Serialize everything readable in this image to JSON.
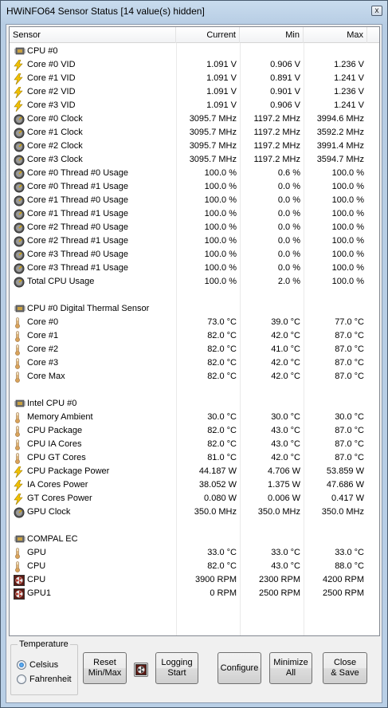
{
  "window": {
    "title": "HWiNFO64 Sensor Status [14 value(s) hidden]",
    "close_glyph": "x"
  },
  "table": {
    "columns": {
      "sensor": "Sensor",
      "current": "Current",
      "min": "Min",
      "max": "Max"
    },
    "rows": [
      {
        "type": "group",
        "icon": "chip-icon",
        "label": "CPU #0"
      },
      {
        "type": "item",
        "icon": "bolt-icon",
        "label": "Core #0 VID",
        "current": "1.091 V",
        "min": "0.906 V",
        "max": "1.236 V"
      },
      {
        "type": "item",
        "icon": "bolt-icon",
        "label": "Core #1 VID",
        "current": "1.091 V",
        "min": "0.891 V",
        "max": "1.241 V"
      },
      {
        "type": "item",
        "icon": "bolt-icon",
        "label": "Core #2 VID",
        "current": "1.091 V",
        "min": "0.901 V",
        "max": "1.236 V"
      },
      {
        "type": "item",
        "icon": "bolt-icon",
        "label": "Core #3 VID",
        "current": "1.091 V",
        "min": "0.906 V",
        "max": "1.241 V"
      },
      {
        "type": "item",
        "icon": "gauge-icon",
        "label": "Core #0 Clock",
        "current": "3095.7 MHz",
        "min": "1197.2 MHz",
        "max": "3994.6 MHz"
      },
      {
        "type": "item",
        "icon": "gauge-icon",
        "label": "Core #1 Clock",
        "current": "3095.7 MHz",
        "min": "1197.2 MHz",
        "max": "3592.2 MHz"
      },
      {
        "type": "item",
        "icon": "gauge-icon",
        "label": "Core #2 Clock",
        "current": "3095.7 MHz",
        "min": "1197.2 MHz",
        "max": "3991.4 MHz"
      },
      {
        "type": "item",
        "icon": "gauge-icon",
        "label": "Core #3 Clock",
        "current": "3095.7 MHz",
        "min": "1197.2 MHz",
        "max": "3594.7 MHz"
      },
      {
        "type": "item",
        "icon": "gauge-icon",
        "label": "Core #0 Thread #0 Usage",
        "current": "100.0 %",
        "min": "0.6 %",
        "max": "100.0 %"
      },
      {
        "type": "item",
        "icon": "gauge-icon",
        "label": "Core #0 Thread #1 Usage",
        "current": "100.0 %",
        "min": "0.0 %",
        "max": "100.0 %"
      },
      {
        "type": "item",
        "icon": "gauge-icon",
        "label": "Core #1 Thread #0 Usage",
        "current": "100.0 %",
        "min": "0.0 %",
        "max": "100.0 %"
      },
      {
        "type": "item",
        "icon": "gauge-icon",
        "label": "Core #1 Thread #1 Usage",
        "current": "100.0 %",
        "min": "0.0 %",
        "max": "100.0 %"
      },
      {
        "type": "item",
        "icon": "gauge-icon",
        "label": "Core #2 Thread #0 Usage",
        "current": "100.0 %",
        "min": "0.0 %",
        "max": "100.0 %"
      },
      {
        "type": "item",
        "icon": "gauge-icon",
        "label": "Core #2 Thread #1 Usage",
        "current": "100.0 %",
        "min": "0.0 %",
        "max": "100.0 %"
      },
      {
        "type": "item",
        "icon": "gauge-icon",
        "label": "Core #3 Thread #0 Usage",
        "current": "100.0 %",
        "min": "0.0 %",
        "max": "100.0 %"
      },
      {
        "type": "item",
        "icon": "gauge-icon",
        "label": "Core #3 Thread #1 Usage",
        "current": "100.0 %",
        "min": "0.0 %",
        "max": "100.0 %"
      },
      {
        "type": "item",
        "icon": "gauge-icon",
        "label": "Total CPU Usage",
        "current": "100.0 %",
        "min": "2.0 %",
        "max": "100.0 %"
      },
      {
        "type": "blank"
      },
      {
        "type": "group",
        "icon": "chip-icon",
        "label": "CPU #0 Digital Thermal Sensor"
      },
      {
        "type": "item",
        "icon": "thermometer-icon",
        "label": "Core #0",
        "current": "73.0 °C",
        "min": "39.0 °C",
        "max": "77.0 °C"
      },
      {
        "type": "item",
        "icon": "thermometer-icon",
        "label": "Core #1",
        "current": "82.0 °C",
        "min": "42.0 °C",
        "max": "87.0 °C"
      },
      {
        "type": "item",
        "icon": "thermometer-icon",
        "label": "Core #2",
        "current": "82.0 °C",
        "min": "41.0 °C",
        "max": "87.0 °C"
      },
      {
        "type": "item",
        "icon": "thermometer-icon",
        "label": "Core #3",
        "current": "82.0 °C",
        "min": "42.0 °C",
        "max": "87.0 °C"
      },
      {
        "type": "item",
        "icon": "thermometer-icon",
        "label": "Core Max",
        "current": "82.0 °C",
        "min": "42.0 °C",
        "max": "87.0 °C"
      },
      {
        "type": "blank"
      },
      {
        "type": "group",
        "icon": "chip-icon",
        "label": "Intel CPU #0"
      },
      {
        "type": "item",
        "icon": "thermometer-icon",
        "label": "Memory Ambient",
        "current": "30.0 °C",
        "min": "30.0 °C",
        "max": "30.0 °C"
      },
      {
        "type": "item",
        "icon": "thermometer-icon",
        "label": "CPU Package",
        "current": "82.0 °C",
        "min": "43.0 °C",
        "max": "87.0 °C"
      },
      {
        "type": "item",
        "icon": "thermometer-icon",
        "label": "CPU IA Cores",
        "current": "82.0 °C",
        "min": "43.0 °C",
        "max": "87.0 °C"
      },
      {
        "type": "item",
        "icon": "thermometer-icon",
        "label": "CPU GT Cores",
        "current": "81.0 °C",
        "min": "42.0 °C",
        "max": "87.0 °C"
      },
      {
        "type": "item",
        "icon": "bolt-icon",
        "label": "CPU Package Power",
        "current": "44.187 W",
        "min": "4.706 W",
        "max": "53.859 W"
      },
      {
        "type": "item",
        "icon": "bolt-icon",
        "label": "IA Cores Power",
        "current": "38.052 W",
        "min": "1.375 W",
        "max": "47.686 W"
      },
      {
        "type": "item",
        "icon": "bolt-icon",
        "label": "GT Cores Power",
        "current": "0.080 W",
        "min": "0.006 W",
        "max": "0.417 W"
      },
      {
        "type": "item",
        "icon": "gauge-icon",
        "label": "GPU Clock",
        "current": "350.0 MHz",
        "min": "350.0 MHz",
        "max": "350.0 MHz"
      },
      {
        "type": "blank"
      },
      {
        "type": "group",
        "icon": "chip-icon",
        "label": "COMPAL EC"
      },
      {
        "type": "item",
        "icon": "thermometer-icon",
        "label": "GPU",
        "current": "33.0 °C",
        "min": "33.0 °C",
        "max": "33.0 °C"
      },
      {
        "type": "item",
        "icon": "thermometer-icon",
        "label": "CPU",
        "current": "82.0 °C",
        "min": "43.0 °C",
        "max": "88.0 °C"
      },
      {
        "type": "item",
        "icon": "fan-icon",
        "label": "CPU",
        "current": "3900 RPM",
        "min": "2300 RPM",
        "max": "4200 RPM"
      },
      {
        "type": "item",
        "icon": "fan-icon",
        "label": "GPU1",
        "current": "0 RPM",
        "min": "2500 RPM",
        "max": "2500 RPM"
      }
    ]
  },
  "controls": {
    "temperature_legend": "Temperature",
    "celsius": "Celsius",
    "fahrenheit": "Fahrenheit",
    "selected_unit": "celsius",
    "reset_minmax": "Reset\nMin/Max",
    "logging_start": "Logging\nStart",
    "configure": "Configure",
    "minimize_all": "Minimize\nAll",
    "close_save": "Close\n& Save"
  },
  "colors": {
    "bolt": "#f2c200",
    "gauge": "#5a5a5a",
    "thermometer": "#d9a35a",
    "fan": "#b03a2e"
  }
}
